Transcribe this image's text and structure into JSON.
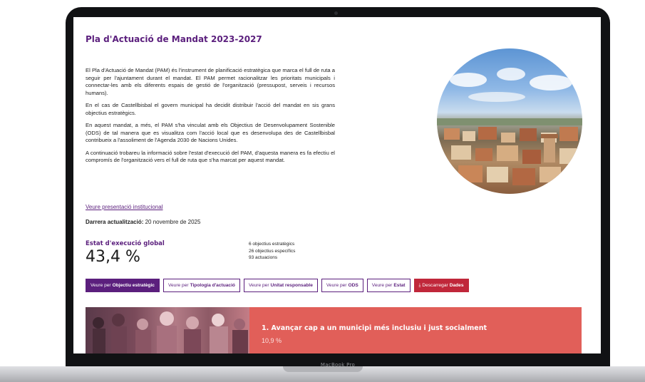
{
  "device": {
    "label": "MacBook Pro"
  },
  "page": {
    "title": "Pla d'Actuació de Mandat 2023-2027",
    "paragraphs": [
      "El Pla d'Actuació de Mandat (PAM) és l'instrument de planificació estratègica que marca el full de ruta a seguir per l'ajuntament durant el mandat. El PAM permet racionalitzar les prioritats municipals i connectar-les amb els diferents espais de gestió de l'organització (pressupost, serveis i recursos humans).",
      "En el cas de Castellbisbal el govern municipal ha decidit distribuir l'acció del mandat en sis grans objectius estratègics.",
      "En aquest mandat, a més, el PAM s'ha vinculat amb els Objectius de Desenvolupament Sostenible (ODS) de tal manera que es visualitza com l'acció local que es desenvolupa des de Castellbisbal contribueix a l'assoliment de l'Agenda 2030 de Nacions Unides.",
      "A continuació trobareu la informació sobre l'estat d'execució del PAM, d'aquesta manera es fa efectiu el compromís de l'organització vers el full de ruta que s'ha marcat per aquest mandat."
    ],
    "presentation_link": "Veure presentació institucional",
    "last_update_label": "Darrera actualització:",
    "last_update_value": "20 novembre de 2025"
  },
  "summary": {
    "label": "Estat d'execució global",
    "value": "43,4 %",
    "progress": 43.4,
    "counts": [
      "6 objectius estratègics",
      "26 objectius específics",
      "93 actuacions"
    ]
  },
  "buttons": [
    {
      "prefix": "Veure per",
      "bold": "Objectiu estratègic"
    },
    {
      "prefix": "Veure per",
      "bold": "Tipologia d'actuació"
    },
    {
      "prefix": "Veure per",
      "bold": "Unitat responsable"
    },
    {
      "prefix": "Veure per",
      "bold": "ODS"
    },
    {
      "prefix": "Veure per",
      "bold": "Estat"
    },
    {
      "prefix": "Descarregar",
      "bold": "Dades"
    }
  ],
  "objective": {
    "title": "1. Avançar cap a un municipi més inclusiu i just socialment",
    "percent": "10,9 %"
  },
  "colors": {
    "brand_purple": "#5b1f7d",
    "download_red": "#c0273a",
    "objective_bg": "#e15f59"
  },
  "icons": {
    "download": "download-icon"
  }
}
